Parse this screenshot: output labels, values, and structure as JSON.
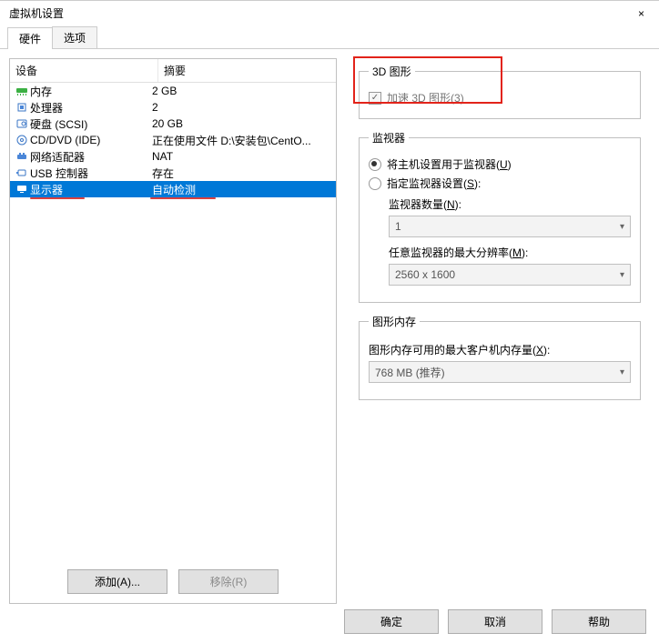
{
  "title": "虚拟机设置",
  "tabs": [
    "硬件",
    "选项"
  ],
  "cols": {
    "device": "设备",
    "summary": "摘要"
  },
  "devices": [
    {
      "n": "内存",
      "s": "2 GB",
      "icon": "memory"
    },
    {
      "n": "处理器",
      "s": "2",
      "icon": "cpu"
    },
    {
      "n": "硬盘 (SCSI)",
      "s": "20 GB",
      "icon": "disk"
    },
    {
      "n": "CD/DVD (IDE)",
      "s": "正在使用文件 D:\\安装包\\CentO...",
      "icon": "cd"
    },
    {
      "n": "网络适配器",
      "s": "NAT",
      "icon": "net"
    },
    {
      "n": "USB 控制器",
      "s": "存在",
      "icon": "usb"
    },
    {
      "n": "显示器",
      "s": "自动检测",
      "icon": "display"
    }
  ],
  "leftButtons": {
    "add": "添加(A)...",
    "remove": "移除(R)"
  },
  "g3d": {
    "legend": "3D 图形",
    "cb": "加速 3D 图形(3)"
  },
  "monitors": {
    "legend": "监视器",
    "r1": "将主机设置用于监视器(U)",
    "r2": "指定监视器设置(S):",
    "countLabel": "监视器数量(N):",
    "countVal": "1",
    "resLabel": "任意监视器的最大分辨率(M):",
    "resVal": "2560 x 1600"
  },
  "gmem": {
    "legend": "图形内存",
    "label": "图形内存可用的最大客户机内存量(X):",
    "val": "768 MB (推荐)"
  },
  "bottom": {
    "ok": "确定",
    "cancel": "取消",
    "help": "帮助"
  }
}
